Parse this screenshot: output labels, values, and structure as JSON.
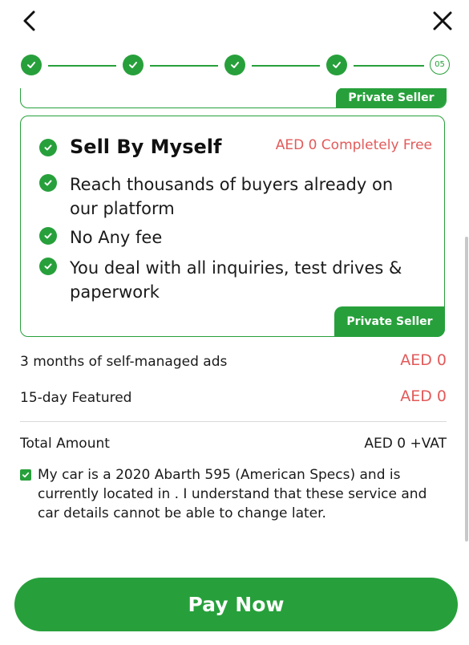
{
  "header": {
    "back_icon": "chevron-left-icon",
    "close_icon": "close-icon"
  },
  "stepper": {
    "steps": [
      {
        "state": "done"
      },
      {
        "state": "done"
      },
      {
        "state": "done"
      },
      {
        "state": "done"
      },
      {
        "state": "current",
        "label": "05"
      }
    ]
  },
  "previous_card": {
    "tag": "Private Seller"
  },
  "plan_card": {
    "title": "Sell By Myself",
    "price": "AED 0 Completely Free",
    "features": [
      "Reach thousands of buyers already on our platform",
      "No Any fee",
      "You deal with all inquiries, test drives & paperwork"
    ],
    "tag": "Private Seller"
  },
  "summary": {
    "items": [
      {
        "label": "3 months of self-managed ads",
        "value": "AED 0"
      },
      {
        "label": "15-day Featured",
        "value": "AED 0"
      }
    ],
    "total_label": "Total Amount",
    "total_value": "AED 0 +VAT"
  },
  "agreement": {
    "checked": true,
    "text": "My car is a 2020 Abarth 595 (American Specs) and is currently located in . I understand that these service and car details cannot be able to change later."
  },
  "pay_button": {
    "label": "Pay Now"
  },
  "colors": {
    "accent": "#27a03b",
    "price": "#e25a5a"
  }
}
